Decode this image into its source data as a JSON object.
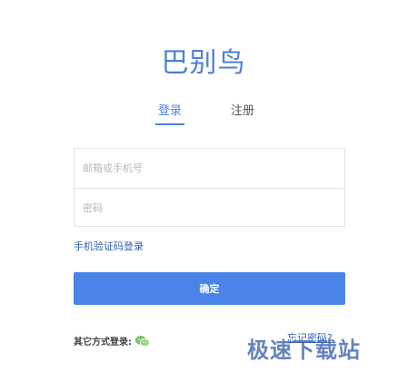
{
  "brand": {
    "logo_text": "巴别鸟",
    "accent_color": "#4a84e0"
  },
  "tabs": {
    "login_label": "登录",
    "register_label": "注册",
    "active": "login"
  },
  "form": {
    "account_placeholder": "邮箱或手机号",
    "password_placeholder": "密码"
  },
  "links": {
    "phone_login": "手机验证码登录",
    "forgot_password": "忘记密码?"
  },
  "confirm_button": {
    "label": "确定",
    "color": "#4a84e8"
  },
  "other_login": {
    "label": "其它方式登录:",
    "icon": "wechat-icon",
    "icon_color": "#7ec36a"
  },
  "watermark": {
    "text": "极速下载站"
  }
}
